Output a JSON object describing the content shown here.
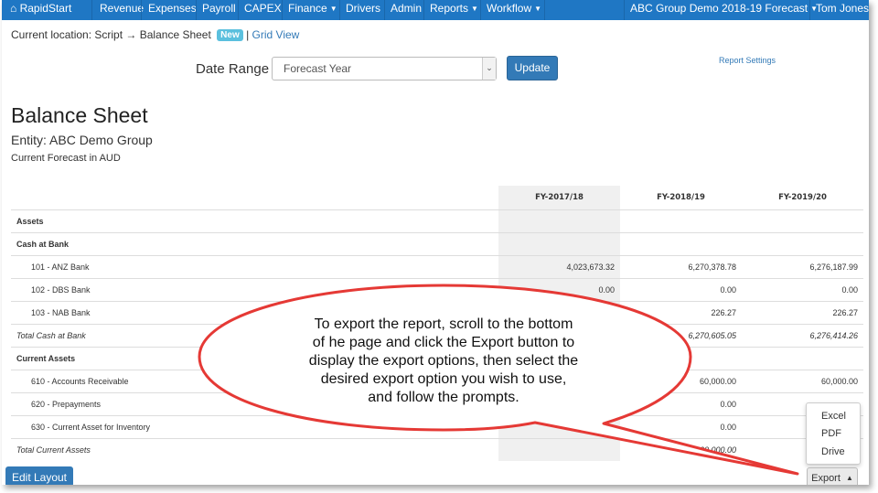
{
  "navbar": {
    "brand": "RapidStart",
    "items": [
      {
        "label": "Revenue",
        "dropdown": false
      },
      {
        "label": "Expenses",
        "dropdown": false
      },
      {
        "label": "Payroll",
        "dropdown": false
      },
      {
        "label": "CAPEX",
        "dropdown": false
      },
      {
        "label": "Finance",
        "dropdown": true
      },
      {
        "label": "Drivers",
        "dropdown": false
      },
      {
        "label": "Admin",
        "dropdown": false
      },
      {
        "label": "Reports",
        "dropdown": true
      },
      {
        "label": "Workflow",
        "dropdown": true
      }
    ],
    "scenario": "ABC Group Demo 2018-19 Forecast",
    "user": "Tom Jones",
    "color": "#1f77c4"
  },
  "breadcrumb": {
    "prefix": "Current location: Script",
    "arrow": "→",
    "current": "Balance Sheet",
    "badge": "New",
    "separator": "|",
    "link": "Grid View"
  },
  "controls": {
    "date_range_label": "Date Range",
    "date_range_value": "Forecast Year",
    "update_label": "Update",
    "report_settings": "Report Settings"
  },
  "report": {
    "title": "Balance Sheet",
    "entity": "Entity: ABC Demo Group",
    "subtitle": "Current Forecast in AUD"
  },
  "table": {
    "columns": [
      "FY-2017/18",
      "FY-2018/19",
      "FY-2019/20"
    ],
    "rows": [
      {
        "label": "Assets",
        "type": "section",
        "values": [
          "",
          "",
          ""
        ]
      },
      {
        "label": "Cash at Bank",
        "type": "section",
        "values": [
          "",
          "",
          ""
        ]
      },
      {
        "label": "101 - ANZ Bank",
        "type": "item",
        "values": [
          "4,023,673.32",
          "6,270,378.78",
          "6,276,187.99"
        ]
      },
      {
        "label": "102 - DBS Bank",
        "type": "item",
        "values": [
          "0.00",
          "0.00",
          "0.00"
        ]
      },
      {
        "label": "103 - NAB Bank",
        "type": "item",
        "values": [
          "",
          "226.27",
          "226.27"
        ]
      },
      {
        "label": "Total Cash at Bank",
        "type": "total",
        "values": [
          "",
          "6,270,605.05",
          "6,276,414.26"
        ]
      },
      {
        "label": "Current Assets",
        "type": "section",
        "values": [
          "",
          "",
          ""
        ]
      },
      {
        "label": "610 - Accounts Receivable",
        "type": "item",
        "values": [
          "",
          "60,000.00",
          "60,000.00"
        ]
      },
      {
        "label": "620 - Prepayments",
        "type": "item",
        "values": [
          "",
          "0.00",
          ""
        ]
      },
      {
        "label": "630 - Current Asset for Inventory",
        "type": "item",
        "values": [
          "",
          "0.00",
          ""
        ]
      },
      {
        "label": "Total Current Assets",
        "type": "total",
        "values": [
          "",
          "60,000.00",
          ""
        ]
      }
    ]
  },
  "bottom": {
    "edit_layout": "Edit Layout",
    "export": "Export",
    "export_options": [
      "Excel",
      "PDF",
      "Drive"
    ]
  },
  "callout": {
    "lines": [
      "To export the report, scroll to the bottom",
      "of he page and click the Export button to",
      "display the export options, then select the",
      "desired export option you wish to use,",
      "and follow the prompts."
    ],
    "stroke_color": "#e53935"
  }
}
